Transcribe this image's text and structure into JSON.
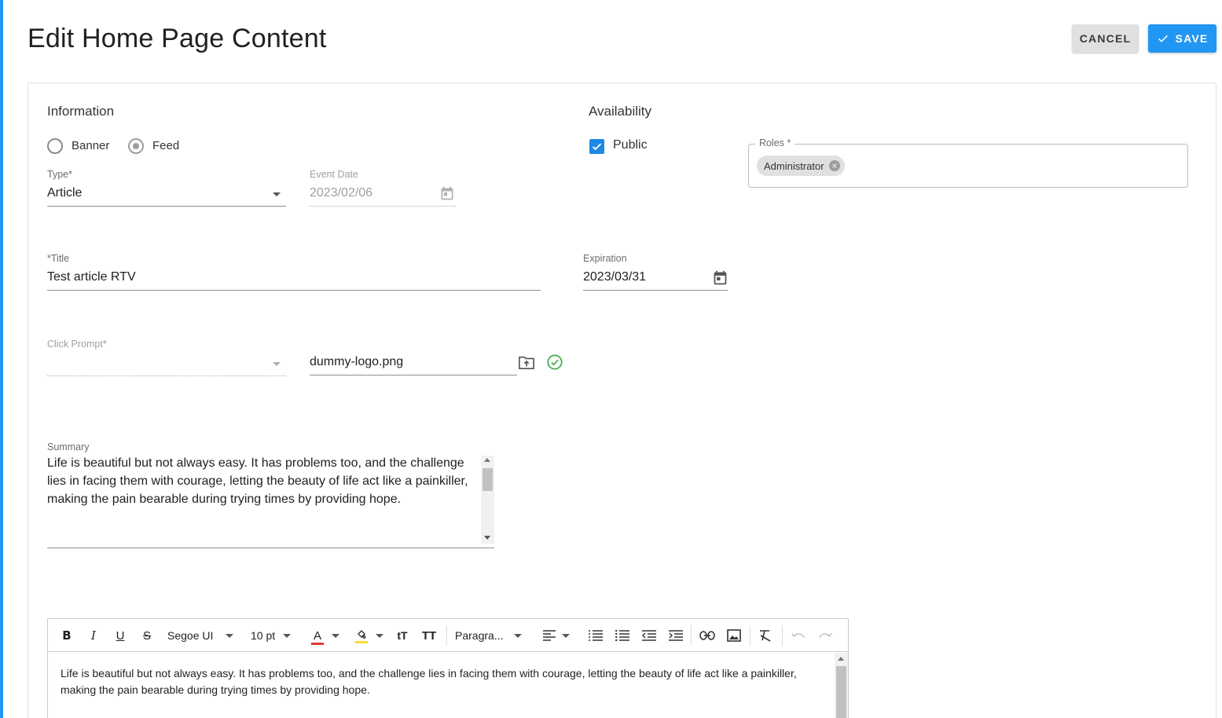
{
  "page": {
    "title": "Edit Home Page Content",
    "cancel_label": "CANCEL",
    "save_label": "SAVE"
  },
  "information": {
    "heading": "Information",
    "content_kind": {
      "options": [
        "Banner",
        "Feed"
      ],
      "selected": "Feed"
    },
    "type": {
      "label": "Type*",
      "value": "Article"
    },
    "event_date": {
      "label": "Event Date",
      "value": "2023/02/06"
    },
    "title": {
      "label": "*Title",
      "value": "Test article RTV"
    },
    "click_prompt": {
      "label": "Click Prompt*",
      "value": ""
    },
    "file": {
      "value": "dummy-logo.png"
    },
    "summary": {
      "label": "Summary",
      "value": "Life is beautiful but not always easy. It has problems too, and the challenge lies in facing them with courage, letting the beauty of life act like a painkiller, making the pain bearable during trying times by providing hope."
    }
  },
  "availability": {
    "heading": "Availability",
    "public": {
      "label": "Public",
      "checked": true
    },
    "roles": {
      "label": "Roles *",
      "chips": [
        "Administrator"
      ]
    },
    "expiration": {
      "label": "Expiration",
      "value": "2023/03/31"
    }
  },
  "editor": {
    "toolbar": {
      "font_family": "Segoe UI",
      "font_size": "10 pt",
      "block_format": "Paragra..."
    },
    "content": "Life is beautiful but not always easy. It has problems too, and the challenge lies in facing them with courage, letting the beauty of life act like a painkiller, making the pain bearable during trying times by providing hope."
  },
  "colors": {
    "accent": "#2196f3",
    "checkbox": "#1e88e5",
    "success": "#4caf50",
    "text_color_swatch": "#e53935",
    "highlight_swatch": "#fdd835"
  }
}
